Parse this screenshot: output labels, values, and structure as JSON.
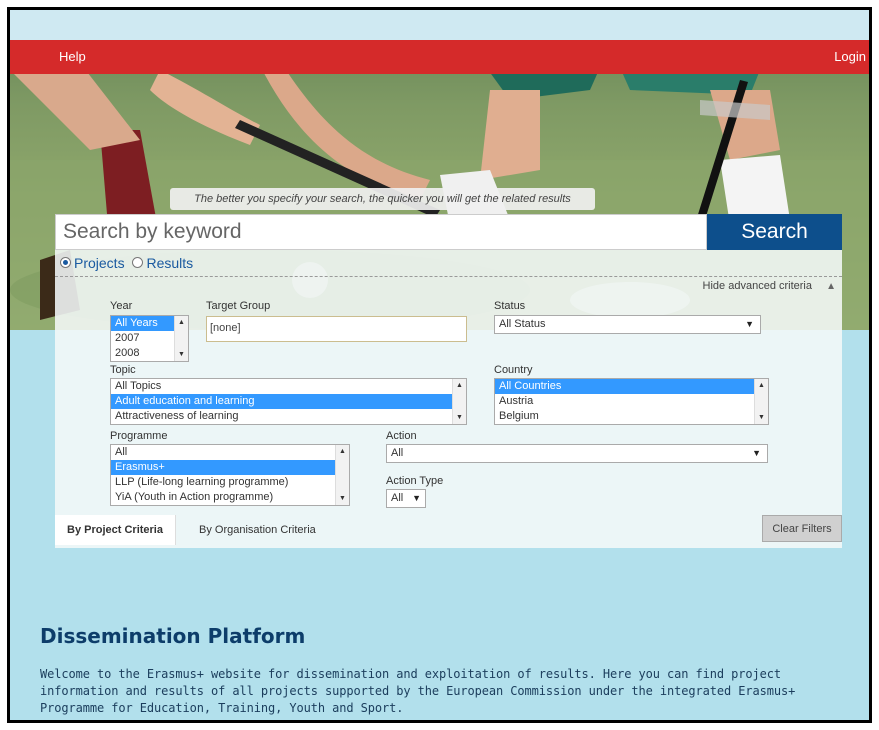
{
  "topbar": {
    "help_label": "Help",
    "login_label": "Login"
  },
  "search": {
    "tip": "The better you specify your search, the quicker you will get the related results",
    "placeholder": "Search by keyword",
    "button_label": "Search"
  },
  "scope": {
    "projects_label": "Projects",
    "results_label": "Results",
    "selected": "Projects"
  },
  "advanced": {
    "hide_label": "Hide advanced criteria"
  },
  "filters": {
    "year": {
      "label": "Year",
      "options": [
        "All Years",
        "2007",
        "2008"
      ],
      "selected": "All Years"
    },
    "target_group": {
      "label": "Target Group",
      "value": "[none]"
    },
    "status": {
      "label": "Status",
      "value": "All Status"
    },
    "topic": {
      "label": "Topic",
      "options": [
        "All Topics",
        "Adult education and learning",
        "Attractiveness of learning"
      ],
      "selected": "Adult education and learning"
    },
    "country": {
      "label": "Country",
      "options": [
        "All Countries",
        "Austria",
        "Belgium"
      ],
      "selected": "All Countries"
    },
    "programme": {
      "label": "Programme",
      "options": [
        "All",
        "Erasmus+",
        "LLP (Life-long learning programme)",
        "YiA (Youth in Action programme)"
      ],
      "selected": "Erasmus+"
    },
    "action": {
      "label": "Action",
      "value": "All"
    },
    "action_type": {
      "label": "Action Type",
      "value": "All"
    }
  },
  "tabs": {
    "project_criteria": "By Project Criteria",
    "organisation_criteria": "By Organisation Criteria",
    "active": "By Project Criteria"
  },
  "clear_filters_label": "Clear Filters",
  "main": {
    "title": "Dissemination Platform",
    "description": "Welcome to the Erasmus+ website for dissemination and exploitation of results. Here you can find project information and results of all projects supported by the European Commission under the integrated Erasmus+ Programme for Education, Training, Youth and Sport."
  },
  "colors": {
    "topbar": "#d52a2a",
    "search_button": "#0d4f8c",
    "page_bg": "#b2e0ec",
    "title": "#0d3d6a",
    "selection": "#3399ff"
  }
}
